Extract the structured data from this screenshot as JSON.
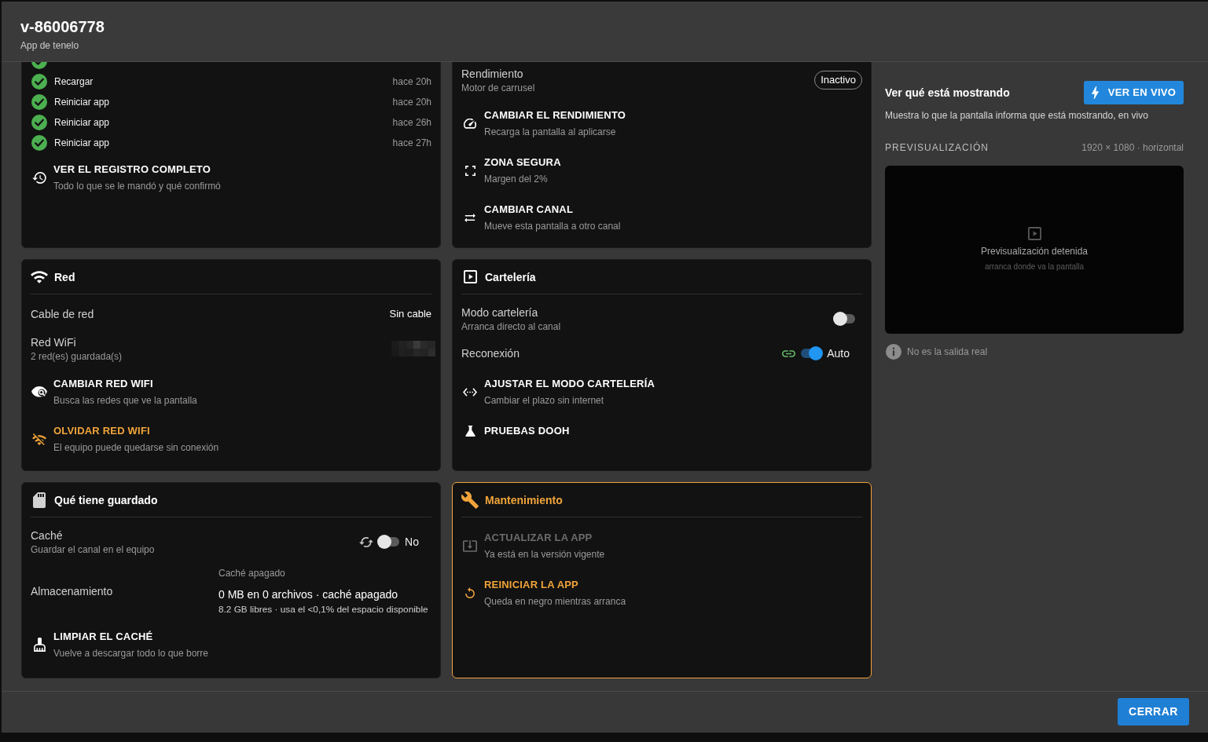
{
  "dialog": {
    "title": "v-86006778",
    "subtitle": "App de tenelo"
  },
  "cards": [
    {
      "warning": false,
      "blocks": [
        {
          "kind": "history",
          "confirmed": true
        },
        {
          "kind": "history",
          "label": "Recargar",
          "time": "hace 20h",
          "confirmed": true
        },
        {
          "kind": "history",
          "label": "Reiniciar app",
          "time": "hace 20h",
          "confirmed": true
        },
        {
          "kind": "history",
          "label": "Reiniciar app",
          "time": "hace 26h",
          "confirmed": true
        },
        {
          "kind": "history",
          "label": "Reiniciar app",
          "time": "hace 27h",
          "confirmed": true
        },
        {
          "kind": "action",
          "title": "VER EL REGISTRO COMPLETO",
          "description": "Todo lo que se le mandó y qué confirmó",
          "warning": false,
          "disabled": false
        }
      ]
    },
    {
      "warning": false,
      "blocks": [
        {
          "kind": "status",
          "label": "Rendimiento",
          "description": "Motor de carrusel",
          "badge": "Inactivo"
        },
        {
          "kind": "action",
          "title": "CAMBIAR EL RENDIMIENTO",
          "description": "Recarga la pantalla al aplicarse",
          "warning": false,
          "disabled": false
        },
        {
          "kind": "action",
          "title": "ZONA SEGURA",
          "description": "Margen del 2%",
          "warning": false,
          "disabled": false
        },
        {
          "kind": "action",
          "title": "CAMBIAR CANAL",
          "description": "Mueve esta pantalla a otro canal",
          "warning": false,
          "disabled": false
        }
      ]
    },
    {
      "title": "Red",
      "warning": false,
      "blocks": [
        {
          "kind": "info",
          "label": "Cable de red",
          "value": "Sin cable"
        },
        {
          "kind": "info",
          "label": "Red WiFi",
          "description": "2 red(es) guardada(s)",
          "redacted": true
        },
        {
          "kind": "action",
          "title": "CAMBIAR RED WIFI",
          "description": "Busca las redes que ve la pantalla",
          "warning": false,
          "disabled": false
        },
        {
          "kind": "action",
          "title": "OLVIDAR RED WIFI",
          "description": "El equipo puede quedarse sin conexión",
          "warning": true,
          "disabled": false
        }
      ]
    },
    {
      "title": "Cartelería",
      "warning": false,
      "blocks": [
        {
          "kind": "toggle",
          "label": "Modo cartelería",
          "description": "Arranca directo al canal",
          "on": false
        },
        {
          "kind": "toggle",
          "label": "Reconexión",
          "on": true,
          "state_label": "Auto"
        },
        {
          "kind": "action",
          "title": "AJUSTAR EL MODO CARTELERÍA",
          "description": "Cambiar el plazo sin internet",
          "warning": false,
          "disabled": false
        },
        {
          "kind": "action",
          "title": "PRUEBAS DOOH",
          "warning": false,
          "disabled": false
        }
      ]
    },
    {
      "title": "Qué tiene guardado",
      "warning": false,
      "blocks": [
        {
          "kind": "toggle",
          "label": "Caché",
          "description": "Guardar el canal en el equipo",
          "on": false,
          "state_label": "No"
        },
        {
          "kind": "storage",
          "label": "Almacenamiento",
          "note": "Caché apagado",
          "value": "0 MB en 0 archivos · caché apagado",
          "detail": "8.2 GB libres · usa el <0,1% del espacio disponible"
        },
        {
          "kind": "action",
          "title": "LIMPIAR EL CACHÉ",
          "description": "Vuelve a descargar todo lo que borre",
          "warning": false,
          "disabled": false
        }
      ]
    },
    {
      "title": "Mantenimiento",
      "warning": true,
      "blocks": [
        {
          "kind": "action",
          "title": "ACTUALIZAR LA APP",
          "description": "Ya está en la versión vigente",
          "warning": false,
          "disabled": true
        },
        {
          "kind": "action",
          "title": "REINICIAR LA APP",
          "description": "Queda en negro mientras arranca",
          "warning": true,
          "disabled": false
        }
      ]
    }
  ],
  "preview_panel": {
    "title": "Ver qué está mostrando",
    "button": "VER EN VIVO",
    "description": "Muestra lo que la pantalla informa que está mostrando, en vivo",
    "section_label": "PREVISUALIZACIÓN",
    "resolution": "1920 × 1080 · horizontal",
    "preview": {
      "status": "Previsualización detenida",
      "hint": "arranca donde va la pantalla"
    },
    "note": "No es la salida real"
  },
  "footer": {
    "buttons": [
      "CERRAR"
    ]
  }
}
